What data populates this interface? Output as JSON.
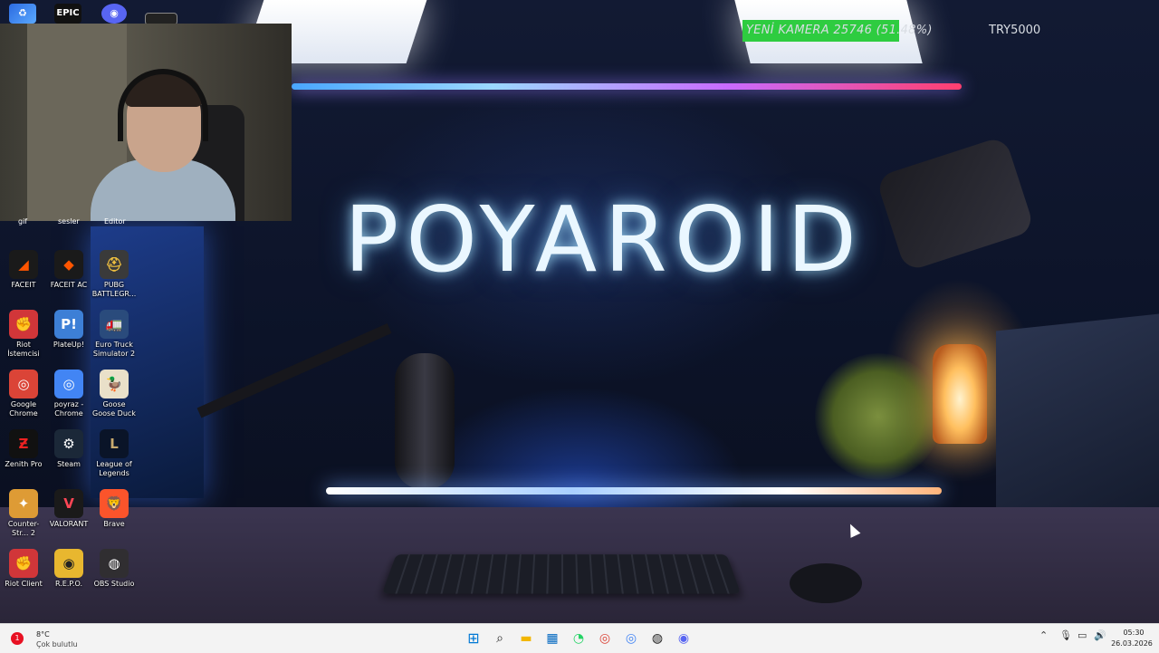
{
  "wallpaper": {
    "brand_title": "POYAROID"
  },
  "donation": {
    "label": "YENİ KAMERA  25746 (51.48%)",
    "goal": "TRY5000",
    "progress_percent": 51.48,
    "bar_color": "#2ecc40"
  },
  "top_icons": [
    {
      "name": "recycle-bin-icon",
      "glyph": "♻"
    },
    {
      "name": "epic-games-icon",
      "glyph": "EPIC"
    },
    {
      "name": "discord-icon",
      "glyph": "◉"
    },
    {
      "name": "app-icon",
      "glyph": ""
    }
  ],
  "cut_labels": [
    "gif",
    "sesler",
    "Editor"
  ],
  "desktop_icons": [
    {
      "label": "FACEIT",
      "glyph": "◢",
      "color": "#ff5500",
      "bg": "#1a1a1a"
    },
    {
      "label": "FACEIT AC",
      "glyph": "◆",
      "color": "#ff5500",
      "bg": "#1a1a1a"
    },
    {
      "label": "PUBG BATTLEGR...",
      "glyph": "⛑",
      "color": "#f0c040",
      "bg": "#3a3a3a"
    },
    {
      "label": "Riot İstemcisi",
      "glyph": "✊",
      "color": "#ffffff",
      "bg": "#d13639"
    },
    {
      "label": "PlateUp!",
      "glyph": "P!",
      "color": "#ffffff",
      "bg": "#3d7fd6"
    },
    {
      "label": "Euro Truck Simulator 2",
      "glyph": "🚛",
      "color": "#ffffff",
      "bg": "#2a4b7c"
    },
    {
      "label": "Google Chrome",
      "glyph": "◎",
      "color": "#ffffff",
      "bg": "#db4437"
    },
    {
      "label": "poyraz - Chrome",
      "glyph": "◎",
      "color": "#ffffff",
      "bg": "#4285f4"
    },
    {
      "label": "Goose Goose Duck",
      "glyph": "🦆",
      "color": "#ffffff",
      "bg": "#e9e0c9"
    },
    {
      "label": "Zenith Pro",
      "glyph": "Ƶ",
      "color": "#e22",
      "bg": "#111111"
    },
    {
      "label": "Steam",
      "glyph": "⚙",
      "color": "#ffffff",
      "bg": "#1b2838"
    },
    {
      "label": "League of Legends",
      "glyph": "L",
      "color": "#c8aa6e",
      "bg": "#0a1428"
    },
    {
      "label": "Counter-Str... 2",
      "glyph": "✦",
      "color": "#ffffff",
      "bg": "#de9b35"
    },
    {
      "label": "VALORANT",
      "glyph": "V",
      "color": "#ff4655",
      "bg": "#1a1a1a"
    },
    {
      "label": "Brave",
      "glyph": "🦁",
      "color": "#ffffff",
      "bg": "#fb542b"
    },
    {
      "label": "Riot Client",
      "glyph": "✊",
      "color": "#ffffff",
      "bg": "#d13639"
    },
    {
      "label": "R.E.P.O.",
      "glyph": "◉",
      "color": "#222222",
      "bg": "#e8b72f"
    },
    {
      "label": "OBS Studio",
      "glyph": "◍",
      "color": "#ffffff",
      "bg": "#302e31"
    }
  ],
  "taskbar": {
    "weather_badge": "1",
    "weather_temp": "8°C",
    "weather_condition": "Çok bulutlu",
    "start_glyph": "⊞",
    "search_glyph": "⌕",
    "explorer_glyph": "▬",
    "store_glyph": "▦",
    "whatsapp_glyph": "◔",
    "chrome_glyph": "◎",
    "chrome2_glyph": "◎",
    "obs_glyph": "◍",
    "discord_glyph": "◉",
    "tray_chevron": "⌃",
    "tray_mic": "🎙",
    "tray_network": "▭",
    "tray_volume": "🔊",
    "time": "05:30",
    "date": "26.03.2026"
  }
}
